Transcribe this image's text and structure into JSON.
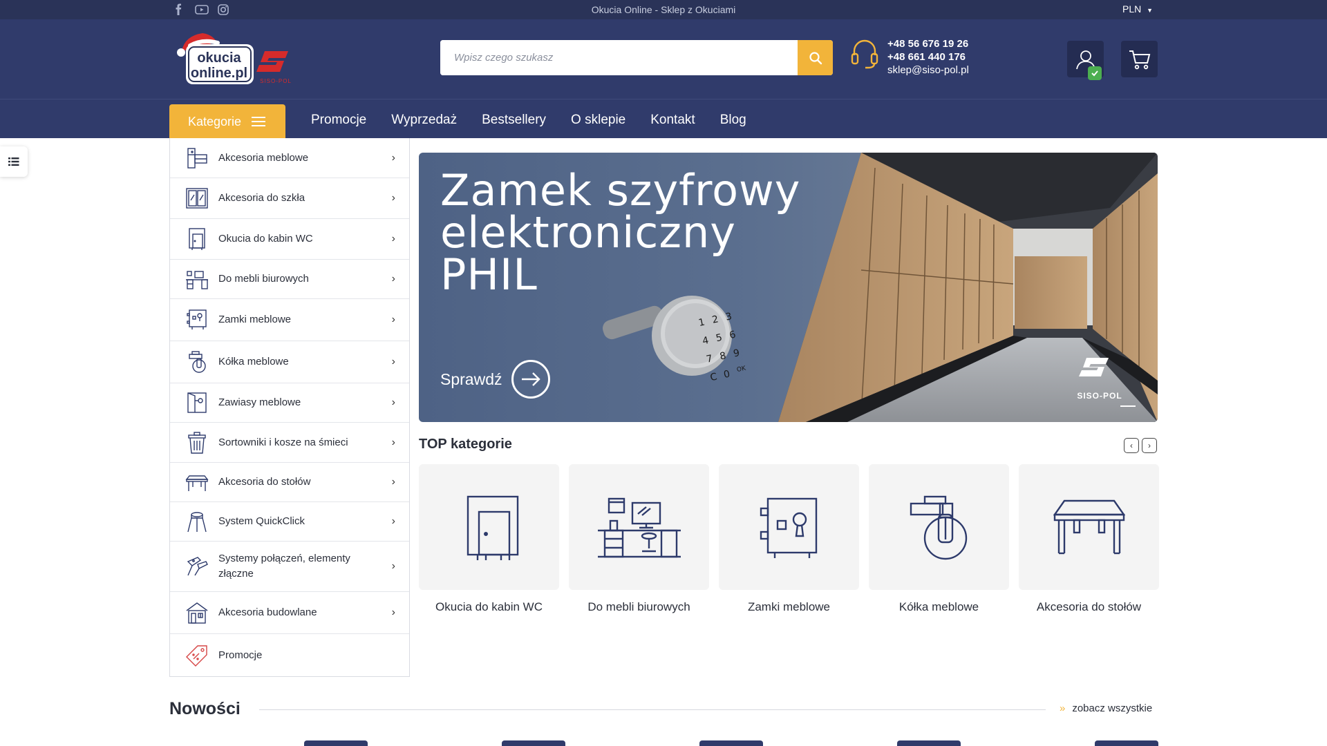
{
  "topbar": {
    "social": [
      "facebook-icon",
      "youtube-icon",
      "instagram-icon"
    ],
    "center_text": "Okucia Online - Sklep z Okuciami",
    "currency": "PLN"
  },
  "header": {
    "logo_text_1": "okucia",
    "logo_text_2": "online.pl",
    "brand_text": "SISO-POL",
    "search_placeholder": "Wpisz czego szukasz",
    "phone_1": "+48 56 676 19 26",
    "phone_2": "+48 661 440 176",
    "email": "sklep@siso-pol.pl"
  },
  "nav": {
    "categories_label": "Kategorie",
    "links": [
      "Promocje",
      "Wyprzedaż",
      "Bestsellery",
      "O sklepie",
      "Kontakt",
      "Blog"
    ]
  },
  "categories": [
    {
      "label": "Akcesoria meblowe",
      "icon": "furniture-accessories-icon"
    },
    {
      "label": "Akcesoria do szkła",
      "icon": "glass-accessories-icon"
    },
    {
      "label": "Okucia do kabin WC",
      "icon": "wc-cabin-icon"
    },
    {
      "label": "Do mebli biurowych",
      "icon": "office-furniture-icon"
    },
    {
      "label": "Zamki meblowe",
      "icon": "furniture-lock-icon"
    },
    {
      "label": "Kółka meblowe",
      "icon": "castor-wheel-icon"
    },
    {
      "label": "Zawiasy meblowe",
      "icon": "hinge-icon"
    },
    {
      "label": "Sortowniki i kosze na śmieci",
      "icon": "trash-bin-icon"
    },
    {
      "label": "Akcesoria do stołów",
      "icon": "table-icon"
    },
    {
      "label": "System QuickClick",
      "icon": "quickclick-icon"
    },
    {
      "label": "Systemy połączeń, elementy złączne",
      "icon": "connectors-icon"
    },
    {
      "label": "Akcesoria budowlane",
      "icon": "building-accessories-icon"
    },
    {
      "label": "Promocje",
      "icon": "promo-tag-icon"
    }
  ],
  "banner": {
    "title": "Zamek szyfrowy elektroniczny PHIL",
    "cta": "Sprawdź",
    "brand": "SISO-POL",
    "keypad": [
      "1",
      "2",
      "3",
      "4",
      "5",
      "6",
      "7",
      "8",
      "9",
      "C",
      "0",
      "OK"
    ]
  },
  "top_categories": {
    "heading": "TOP kategorie",
    "items": [
      {
        "label": "Okucia do kabin WC",
        "icon": "wc-cabin-icon"
      },
      {
        "label": "Do mebli biurowych",
        "icon": "office-furniture-icon"
      },
      {
        "label": "Zamki meblowe",
        "icon": "furniture-lock-icon"
      },
      {
        "label": "Kółka meblowe",
        "icon": "castor-wheel-icon"
      },
      {
        "label": "Akcesoria do stołów",
        "icon": "table-icon"
      }
    ]
  },
  "new_products": {
    "heading": "Nowości",
    "see_all": "zobacz wszystkie"
  },
  "colors": {
    "navy": "#303b6b",
    "dark_navy": "#2a3358",
    "accent": "#f2b43a",
    "icon_stroke": "#2d3a6b"
  }
}
